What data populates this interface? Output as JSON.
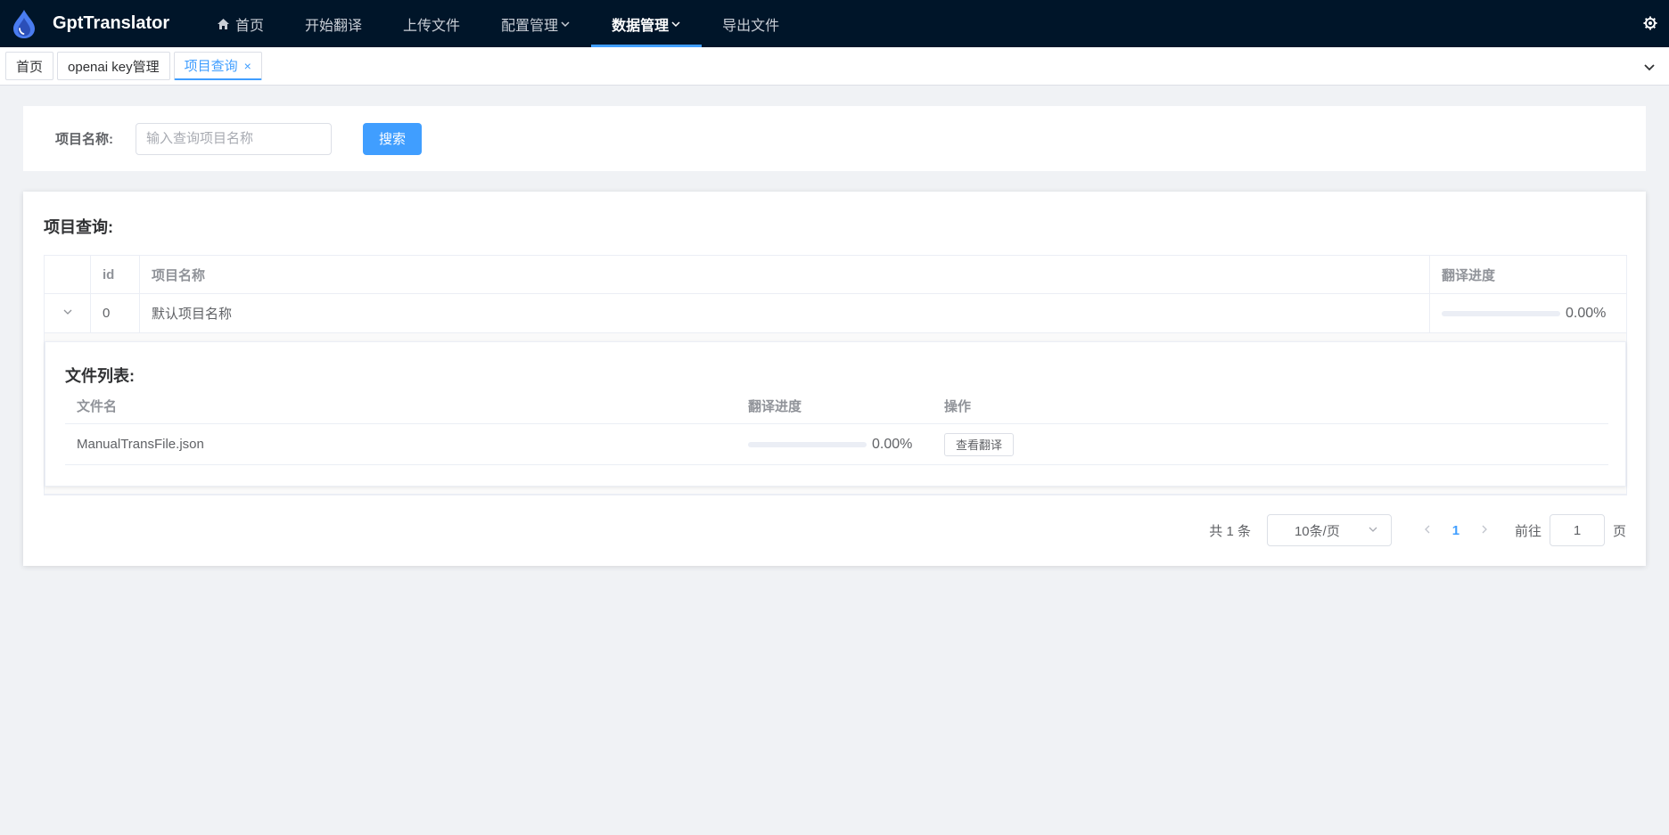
{
  "app": {
    "title": "GptTranslator"
  },
  "nav": {
    "items": [
      {
        "label": "首页"
      },
      {
        "label": "开始翻译"
      },
      {
        "label": "上传文件"
      },
      {
        "label": "配置管理"
      },
      {
        "label": "数据管理"
      },
      {
        "label": "导出文件"
      }
    ]
  },
  "tags": {
    "items": [
      {
        "label": "首页"
      },
      {
        "label": "openai key管理"
      },
      {
        "label": "项目查询",
        "close": "×"
      }
    ]
  },
  "search": {
    "label": "项目名称:",
    "placeholder": "输入查询项目名称",
    "button": "搜索"
  },
  "main": {
    "title": "项目查询:",
    "table": {
      "headers": {
        "id": "id",
        "name": "项目名称",
        "progress": "翻译进度"
      },
      "rows": [
        {
          "id": "0",
          "name": "默认项目名称",
          "progress_value": 0.0,
          "progress_text": "0.00%"
        }
      ]
    },
    "files": {
      "title": "文件列表:",
      "headers": {
        "name": "文件名",
        "progress": "翻译进度",
        "op": "操作"
      },
      "rows": [
        {
          "name": "ManualTransFile.json",
          "progress_value": 0.0,
          "progress_text": "0.00%",
          "action": "查看翻译"
        }
      ]
    }
  },
  "pagination": {
    "total": "共 1 条",
    "page_size": "10条/页",
    "current": "1",
    "goto_label": "前往",
    "goto_value": "1",
    "page_suffix": "页"
  },
  "colors": {
    "nav_bg": "#001529",
    "accent": "#409eff",
    "page_bg": "#f0f2f5"
  }
}
